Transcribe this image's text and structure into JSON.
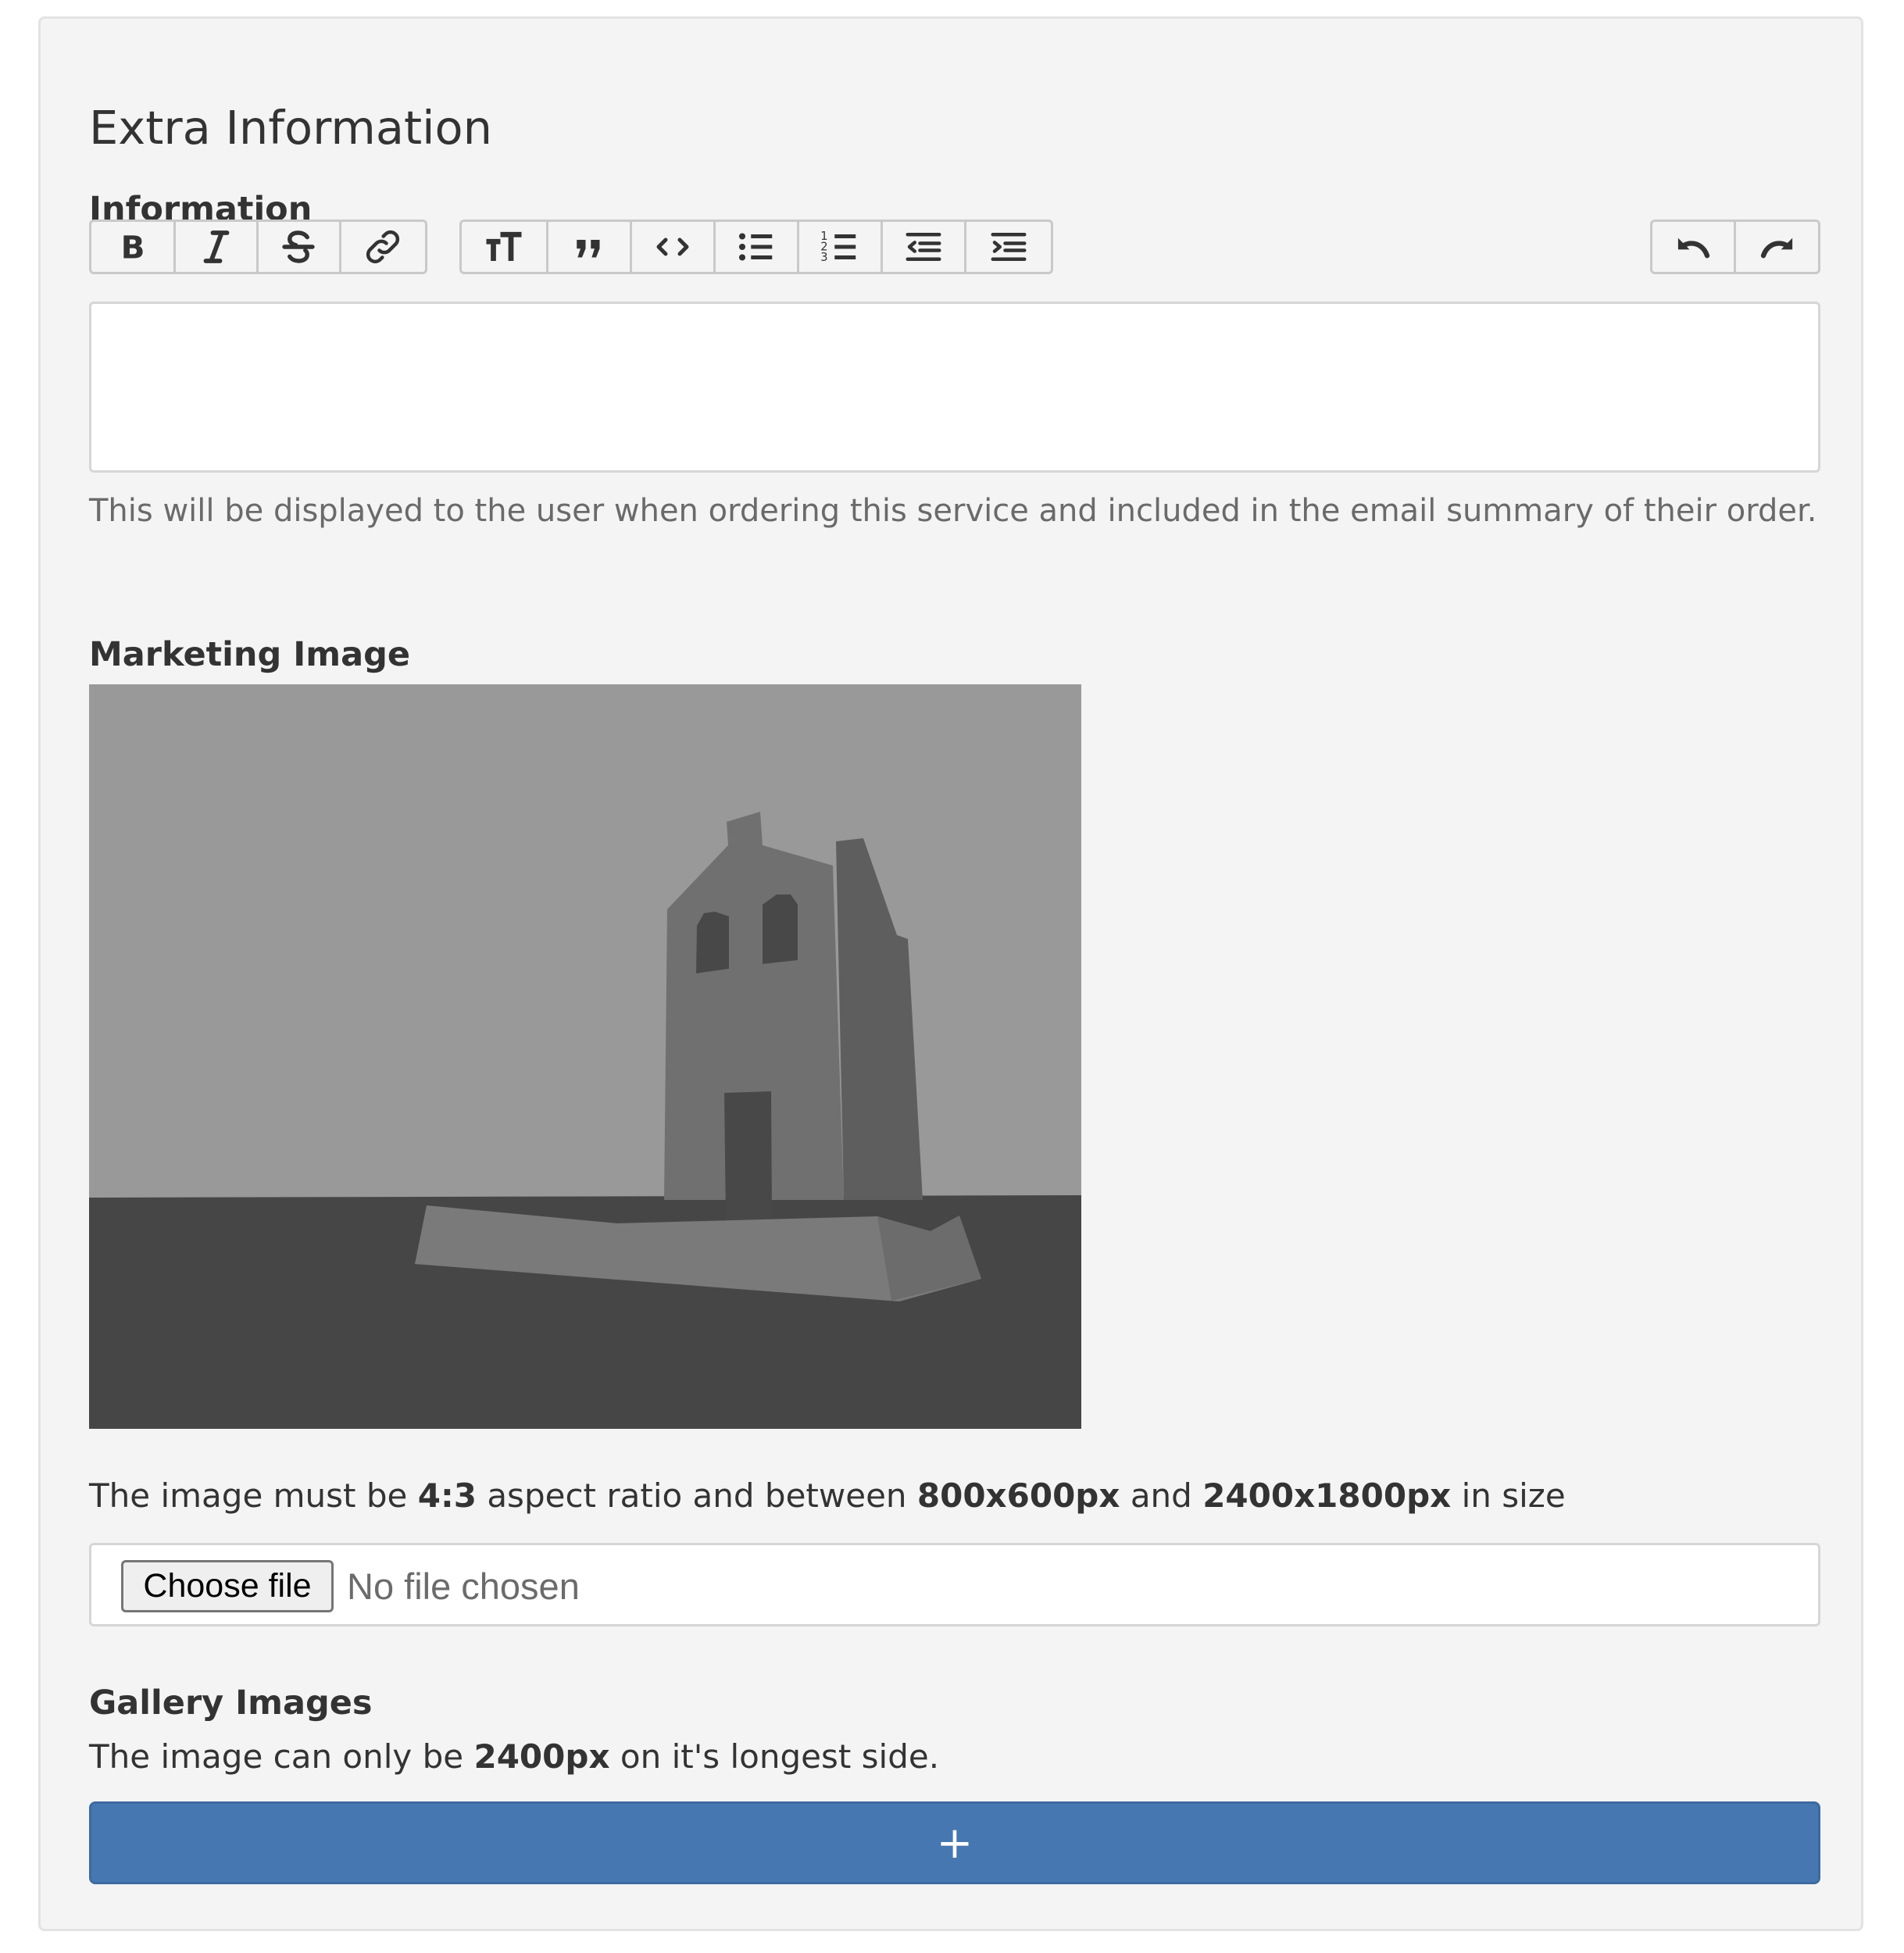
{
  "section": {
    "title": "Extra Information"
  },
  "information": {
    "label": "Information",
    "toolbar": {
      "format_group": [
        {
          "name": "bold-button",
          "icon": "bold-icon",
          "tooltip": "Bold"
        },
        {
          "name": "italic-button",
          "icon": "italic-icon",
          "tooltip": "Italic"
        },
        {
          "name": "strikethrough-button",
          "icon": "strikethrough-icon",
          "tooltip": "Strikethrough"
        },
        {
          "name": "link-button",
          "icon": "link-icon",
          "tooltip": "Link"
        }
      ],
      "block_group": [
        {
          "name": "heading-button",
          "icon": "heading-icon",
          "tooltip": "Heading"
        },
        {
          "name": "quote-button",
          "icon": "quote-icon",
          "tooltip": "Quote"
        },
        {
          "name": "code-button",
          "icon": "code-icon",
          "tooltip": "Code"
        },
        {
          "name": "bullet-list-button",
          "icon": "bullet-list-icon",
          "tooltip": "Bullets"
        },
        {
          "name": "numbered-list-button",
          "icon": "numbered-list-icon",
          "tooltip": "Numbers"
        },
        {
          "name": "outdent-button",
          "icon": "outdent-icon",
          "tooltip": "Decrease Level"
        },
        {
          "name": "indent-button",
          "icon": "indent-icon",
          "tooltip": "Increase Level"
        }
      ],
      "history_group": [
        {
          "name": "undo-button",
          "icon": "undo-icon",
          "tooltip": "Undo"
        },
        {
          "name": "redo-button",
          "icon": "redo-icon",
          "tooltip": "Redo"
        }
      ]
    },
    "editor_value": "",
    "help_text": "This will be displayed to the user when ordering this service and included in the email summary of their order."
  },
  "marketing": {
    "label": "Marketing Image",
    "image_icon": "image-placeholder-icon",
    "requirement": {
      "prefix": "The image must be ",
      "ratio": "4:3",
      "middle": " aspect ratio and between ",
      "min_size": "800x600px",
      "and": " and ",
      "max_size": "2400x1800px",
      "suffix": " in size"
    },
    "file_input": {
      "button_label": "Choose file",
      "status": "No file chosen"
    }
  },
  "gallery": {
    "label": "Gallery Images",
    "requirement": {
      "prefix": "The image can only be ",
      "max": "2400px",
      "suffix": " on it's longest side."
    },
    "add_button_label": "+"
  },
  "colors": {
    "panel_background": "#f4f4f4",
    "primary_button": "#4677b1",
    "help_text": "#6a6a6a"
  }
}
